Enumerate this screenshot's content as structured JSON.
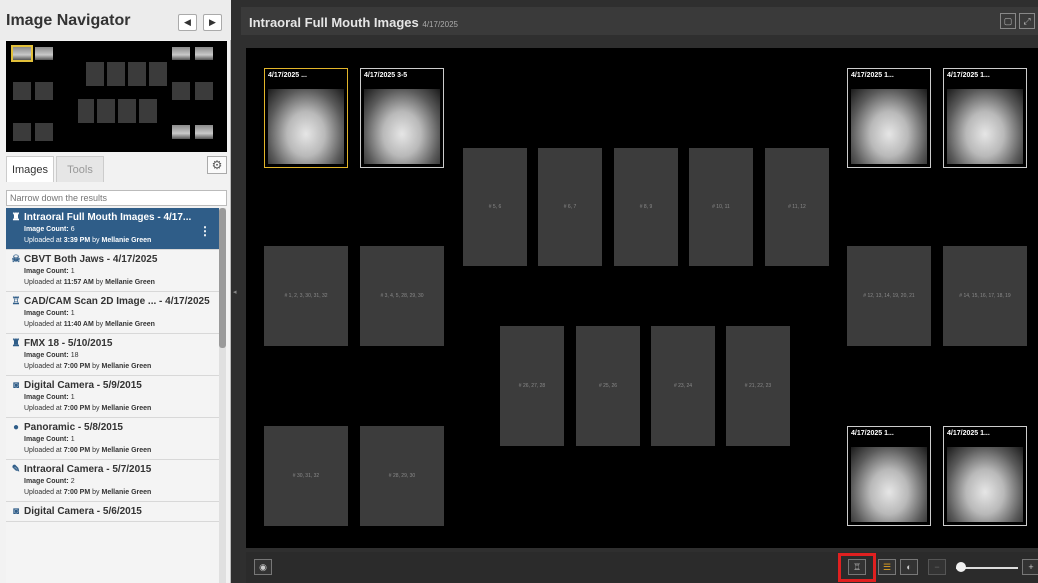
{
  "navigator": {
    "title": "Image Navigator",
    "prev_icon": "◀",
    "next_icon": "▶"
  },
  "tabs": {
    "images": "Images",
    "tools": "Tools",
    "gear_icon": "⚙"
  },
  "search": {
    "placeholder": "Narrow down the results"
  },
  "list": [
    {
      "icon": "tooth-icon",
      "glyph": "♜",
      "title": "Intraoral Full Mouth Images - 4/17...",
      "count": "6",
      "time": "3:39 PM",
      "user": "Mellanie Green",
      "selected": true
    },
    {
      "icon": "skull-icon",
      "glyph": "☠",
      "title": "CBVT Both Jaws - 4/17/2025",
      "count": "1",
      "time": "11:57 AM",
      "user": "Mellanie Green"
    },
    {
      "icon": "tooth-outline-icon",
      "glyph": "♖",
      "title": "CAD/CAM Scan 2D Image ... - 4/17/2025",
      "count": "1",
      "time": "11:40 AM",
      "user": "Mellanie Green"
    },
    {
      "icon": "tooth-icon",
      "glyph": "♜",
      "title": "FMX 18 - 5/10/2015",
      "count": "18",
      "time": "7:00 PM",
      "user": "Mellanie Green"
    },
    {
      "icon": "camera-icon",
      "glyph": "◙",
      "title": "Digital Camera - 5/9/2015",
      "count": "1",
      "time": "7:00 PM",
      "user": "Mellanie Green"
    },
    {
      "icon": "person-icon",
      "glyph": "●",
      "title": "Panoramic - 5/8/2015",
      "count": "1",
      "time": "7:00 PM",
      "user": "Mellanie Green"
    },
    {
      "icon": "pen-icon",
      "glyph": "✎",
      "title": "Intraoral Camera - 5/7/2015",
      "count": "2",
      "time": "7:00 PM",
      "user": "Mellanie Green"
    },
    {
      "icon": "camera-icon",
      "glyph": "◙",
      "title": "Digital Camera - 5/6/2015",
      "count": "",
      "time": "",
      "user": ""
    }
  ],
  "labels": {
    "image_count": "Image Count:",
    "uploaded_at": "Uploaded at",
    "by": "by"
  },
  "viewer": {
    "title": "Intraoral Full Mouth Images",
    "date": "4/17/2025",
    "images": [
      {
        "caption": "4/17/2025 ..."
      },
      {
        "caption": "4/17/2025 3-5"
      },
      {
        "caption": "4/17/2025 1..."
      },
      {
        "caption": "4/17/2025 1..."
      },
      {
        "caption": "4/17/2025 1..."
      },
      {
        "caption": "4/17/2025 1..."
      }
    ],
    "slots": [
      "# 5, 6",
      "# 6, 7",
      "# 8, 9",
      "# 10, 11",
      "# 11, 12",
      "# 1, 2, 3, 30, 31, 32",
      "# 3, 4, 5, 28, 29, 30",
      "# 12, 13, 14, 19, 20, 21",
      "# 14, 15, 16, 17, 18, 19",
      "# 26, 27, 28",
      "# 25, 26",
      "# 23, 24",
      "# 21, 22, 23",
      "# 30, 31, 32",
      "# 28, 29, 30"
    ]
  },
  "colors": {
    "selected_item": "#2f5d88",
    "highlight": "#e02020",
    "selected_image": "#e2b52a"
  }
}
